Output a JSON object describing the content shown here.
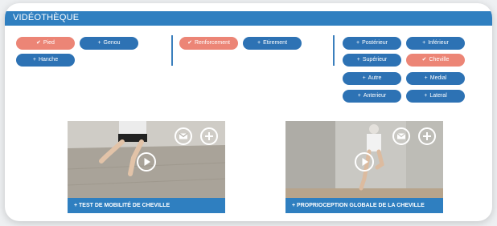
{
  "header": {
    "title": "VIDÉOTHÈQUE"
  },
  "filters": {
    "area": [
      {
        "label": "Pied",
        "selected": true
      },
      {
        "label": "Genou",
        "selected": false
      },
      {
        "label": "Hanche",
        "selected": false
      }
    ],
    "type": [
      {
        "label": "Renforcement",
        "selected": true
      },
      {
        "label": "Etirement",
        "selected": false
      }
    ],
    "location": [
      {
        "label": "Postérieur",
        "selected": false
      },
      {
        "label": "Inférieur",
        "selected": false
      },
      {
        "label": "Supérieur",
        "selected": false
      },
      {
        "label": "Cheville",
        "selected": true
      },
      {
        "label": "Autre",
        "selected": false
      },
      {
        "label": "Medial",
        "selected": false
      },
      {
        "label": "Anterieur",
        "selected": false
      },
      {
        "label": "Lateral",
        "selected": false
      }
    ]
  },
  "icons": {
    "selected": "check-icon",
    "unselected": "plus-icon"
  },
  "marks": {
    "selected": "✔",
    "unselected": "+"
  },
  "videos": [
    {
      "caption": "+ TEST DE MOBILITÉ DE CHEVILLE",
      "icons": [
        "mail-icon",
        "add-icon",
        "play-icon"
      ]
    },
    {
      "caption": "+ PROPRIOCEPTION GLOBALE DE LA CHEVILLE",
      "icons": [
        "mail-icon",
        "add-icon",
        "play-icon"
      ]
    }
  ],
  "colors": {
    "accent": "#2f7fc0",
    "selected": "#ec8576",
    "button": "#2d72b4"
  }
}
